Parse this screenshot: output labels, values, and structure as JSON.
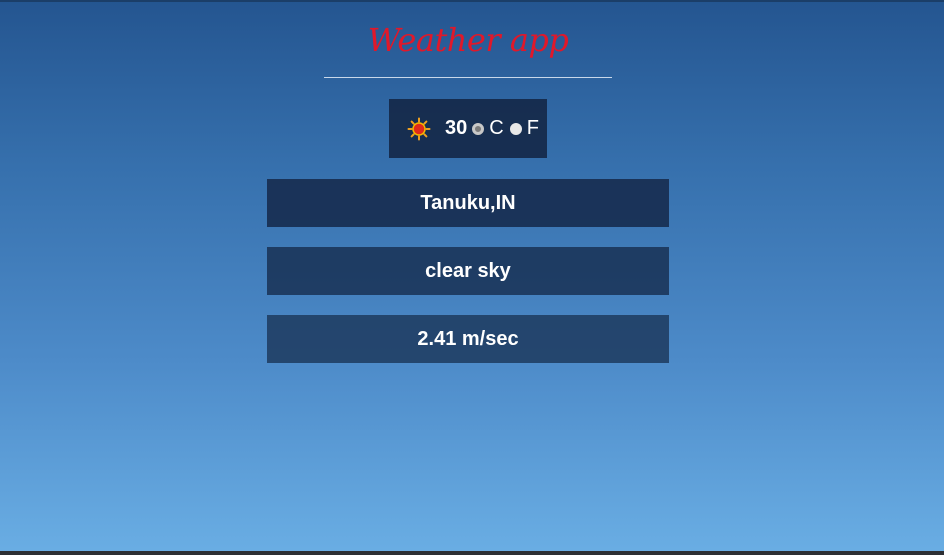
{
  "app": {
    "title": "Weather app"
  },
  "current": {
    "temperature": "30",
    "icon": "sun-icon",
    "units": [
      {
        "label": "C",
        "selected": true
      },
      {
        "label": "F",
        "selected": false
      }
    ],
    "location": "Tanuku,IN",
    "description": "clear sky",
    "wind_speed": "2.41 m/sec"
  },
  "colors": {
    "title": "#e0182a",
    "background_top": "#245590",
    "background_bottom": "#6aaee4",
    "panel": "#132644"
  }
}
